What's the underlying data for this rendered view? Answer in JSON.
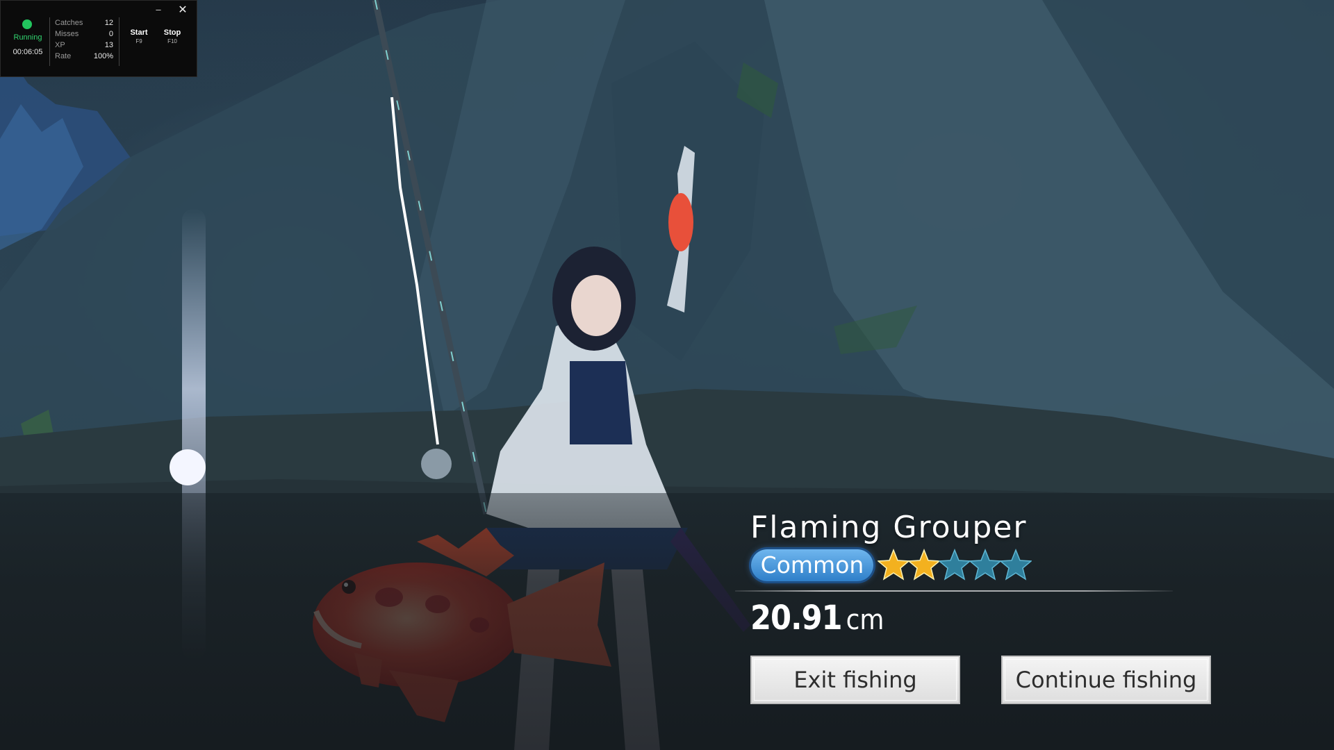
{
  "bot_overlay": {
    "status": "Running",
    "timer": "00:06:05",
    "stats": [
      {
        "label": "Catches",
        "value": "12"
      },
      {
        "label": "Misses",
        "value": "0"
      },
      {
        "label": "XP",
        "value": "13"
      },
      {
        "label": "Rate",
        "value": "100%"
      }
    ],
    "start": {
      "label": "Start",
      "key": "F9"
    },
    "stop": {
      "label": "Stop",
      "key": "F10"
    },
    "minimize_glyph": "–",
    "close_glyph": "✕",
    "status_color": "#22c55e"
  },
  "catch": {
    "fish_name": "Flaming Grouper",
    "rarity": "Common",
    "stars_filled": 2,
    "stars_total": 5,
    "length_value": "20.91",
    "length_unit": "cm",
    "exit_label": "Exit fishing",
    "continue_label": "Continue fishing",
    "colors": {
      "star_filled": "#f3b11f",
      "star_empty": "#2f7f9c",
      "rarity_badge": "#3f8fd8"
    }
  }
}
